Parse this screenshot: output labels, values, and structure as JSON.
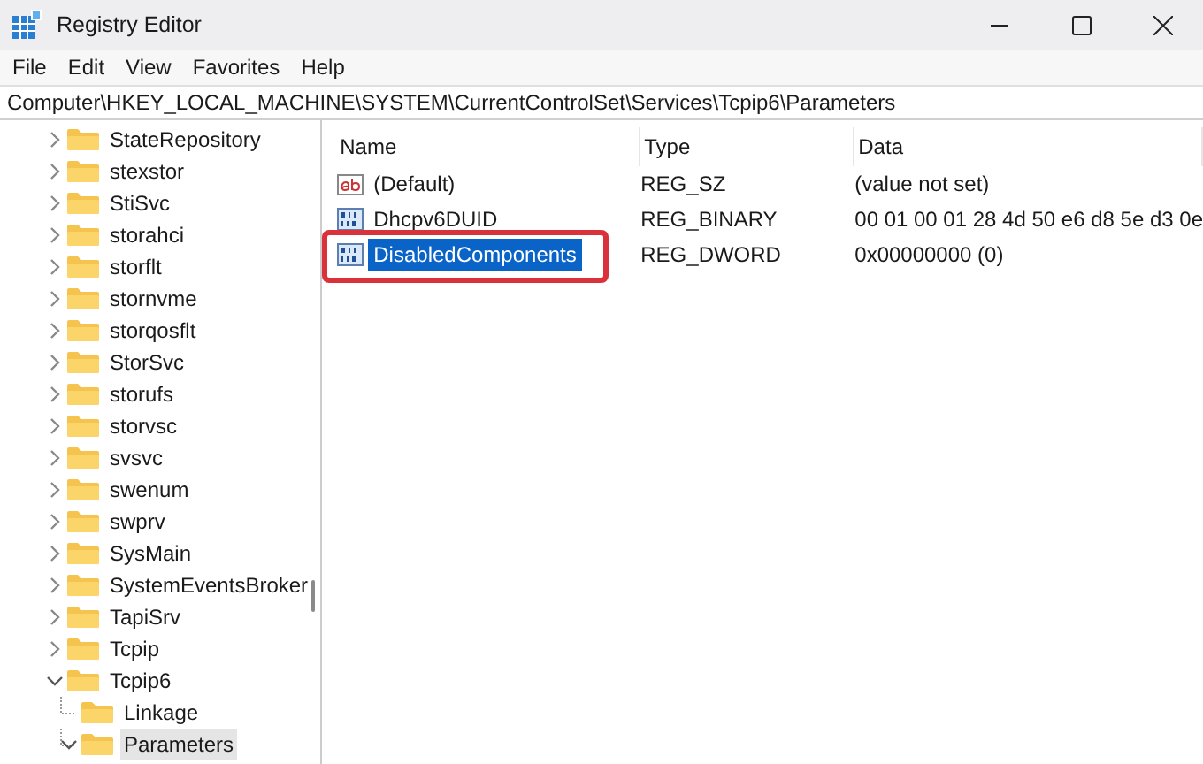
{
  "window": {
    "title": "Registry Editor"
  },
  "menu": [
    "File",
    "Edit",
    "View",
    "Favorites",
    "Help"
  ],
  "address_bar": "Computer\\HKEY_LOCAL_MACHINE\\SYSTEM\\CurrentControlSet\\Services\\Tcpip6\\Parameters",
  "tree": [
    {
      "label": "StateRepository",
      "expanded": false,
      "selected": false
    },
    {
      "label": "stexstor",
      "expanded": false,
      "selected": false
    },
    {
      "label": "StiSvc",
      "expanded": false,
      "selected": false
    },
    {
      "label": "storahci",
      "expanded": false,
      "selected": false
    },
    {
      "label": "storflt",
      "expanded": false,
      "selected": false
    },
    {
      "label": "stornvme",
      "expanded": false,
      "selected": false
    },
    {
      "label": "storqosflt",
      "expanded": false,
      "selected": false
    },
    {
      "label": "StorSvc",
      "expanded": false,
      "selected": false
    },
    {
      "label": "storufs",
      "expanded": false,
      "selected": false
    },
    {
      "label": "storvsc",
      "expanded": false,
      "selected": false
    },
    {
      "label": "svsvc",
      "expanded": false,
      "selected": false
    },
    {
      "label": "swenum",
      "expanded": false,
      "selected": false
    },
    {
      "label": "swprv",
      "expanded": false,
      "selected": false
    },
    {
      "label": "SysMain",
      "expanded": false,
      "selected": false
    },
    {
      "label": "SystemEventsBroker",
      "expanded": false,
      "selected": false
    },
    {
      "label": "TapiSrv",
      "expanded": false,
      "selected": false
    },
    {
      "label": "Tcpip",
      "expanded": false,
      "selected": false
    },
    {
      "label": "Tcpip6",
      "expanded": true,
      "selected": false,
      "children": [
        {
          "label": "Linkage",
          "selected": false
        },
        {
          "label": "Parameters",
          "expanded": true,
          "selected": true
        }
      ]
    }
  ],
  "table": {
    "columns": [
      "Name",
      "Type",
      "Data"
    ],
    "rows": [
      {
        "kind": "string",
        "name": "(Default)",
        "type": "REG_SZ",
        "data": "(value not set)",
        "selected": false,
        "highlighted": false
      },
      {
        "kind": "binary",
        "name": "Dhcpv6DUID",
        "type": "REG_BINARY",
        "data": "00 01 00 01 28 4d 50 e6 d8 5e d3 0e",
        "selected": false,
        "highlighted": false
      },
      {
        "kind": "binary",
        "name": "DisabledComponents",
        "type": "REG_DWORD",
        "data": "0x00000000 (0)",
        "selected": true,
        "highlighted": true
      }
    ]
  }
}
